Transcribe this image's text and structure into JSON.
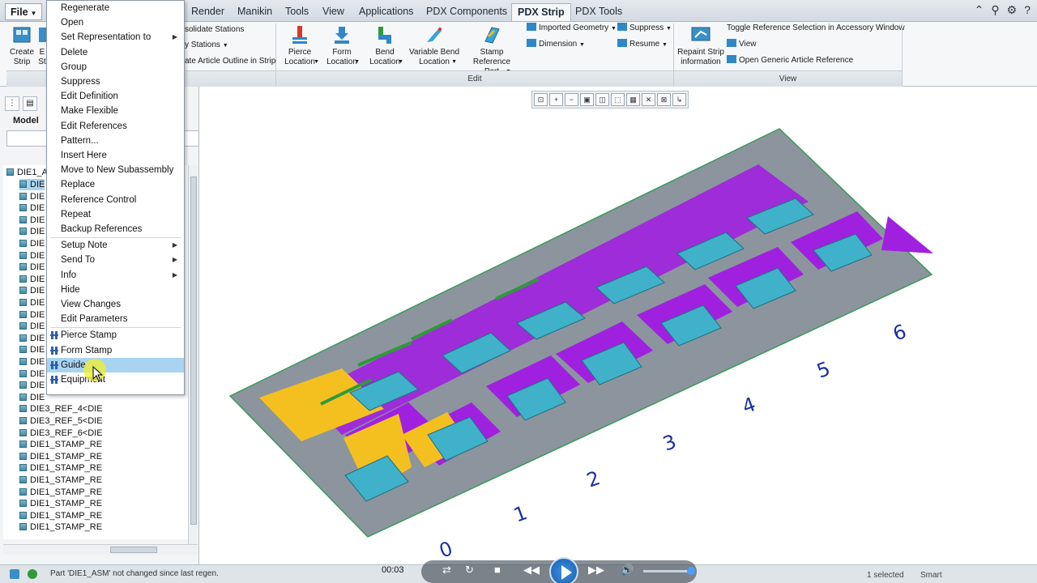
{
  "tabs": {
    "file": "File",
    "items": [
      "Render",
      "Manikin",
      "Tools",
      "View",
      "Applications",
      "PDX Components",
      "PDX Strip",
      "PDX Tools"
    ],
    "active": "PDX Strip"
  },
  "ribbon": {
    "strip_group": {
      "create_strip": "Create\nStrip",
      "create_strip_2": "E\nSt",
      "consolidate_stations": "solidate Stations",
      "copy_stations": "y Stations",
      "article_outline": "ate Article Outline in Strip"
    },
    "edit_group": {
      "label": "Edit",
      "pierce_location": "Pierce\nLocation",
      "form_location": "Form\nLocation",
      "bend_location": "Bend\nLocation",
      "variable_bend_location": "Variable Bend\nLocation",
      "stamp_reference_part": "Stamp Reference\nPart",
      "imported_geometry": "Imported Geometry",
      "dimension": "Dimension",
      "suppress": "Suppress",
      "resume": "Resume"
    },
    "view_group": {
      "label": "View",
      "repaint_strip": "Repaint Strip\ninformation",
      "toggle_reference": "Toggle Reference Selection in Accessory Window",
      "view": "View",
      "open_generic": "Open Generic Article Reference"
    }
  },
  "left_panel": {
    "model_tab": "Model",
    "tree": {
      "root": "DIE1_A",
      "items": [
        "DIE",
        "DIE",
        "DIE",
        "DIE",
        "DIE",
        "DIE",
        "DIE",
        "DIE",
        "DIE",
        "DIE",
        "DIE",
        "DIE",
        "DIE",
        "DIE",
        "DIE",
        "DIE",
        "DIE",
        "DIE",
        "DIE",
        "DIE3_REF_4<DIE",
        "DIE3_REF_5<DIE",
        "DIE3_REF_6<DIE",
        "DIE1_STAMP_RE",
        "DIE1_STAMP_RE",
        "DIE1_STAMP_RE",
        "DIE1_STAMP_RE",
        "DIE1_STAMP_RE",
        "DIE1_STAMP_RE",
        "DIE1_STAMP_RE",
        "DIE1_STAMP_RE"
      ]
    }
  },
  "context_menu": {
    "items": [
      {
        "label": "Regenerate"
      },
      {
        "label": "Open"
      },
      {
        "label": "Set Representation to",
        "submenu": true
      },
      {
        "label": "Delete"
      },
      {
        "label": "Group"
      },
      {
        "label": "Suppress"
      },
      {
        "label": "Edit Definition"
      },
      {
        "label": "Make Flexible"
      },
      {
        "label": "Edit References"
      },
      {
        "label": "Pattern..."
      },
      {
        "label": "Insert Here"
      },
      {
        "label": "Move to New Subassembly"
      },
      {
        "label": "Replace"
      },
      {
        "label": "Reference Control"
      },
      {
        "label": "Repeat"
      },
      {
        "label": "Backup References"
      },
      {
        "label": "Setup Note",
        "submenu": true
      },
      {
        "label": "Send To",
        "submenu": true
      },
      {
        "label": "Info",
        "submenu": true
      },
      {
        "label": "Hide"
      },
      {
        "label": "View Changes"
      },
      {
        "label": "Edit Parameters"
      },
      {
        "label": "Pierce Stamp",
        "icon": "pierce-stamp-icon"
      },
      {
        "label": "Form Stamp",
        "icon": "form-stamp-icon"
      },
      {
        "label": "Guide",
        "icon": "guide-icon",
        "highlighted": true
      },
      {
        "label": "Equipment",
        "icon": "equipment-icon"
      }
    ]
  },
  "graphics": {
    "station_numbers": [
      "0",
      "1",
      "2",
      "3",
      "4",
      "5",
      "6"
    ],
    "colors": {
      "plate": "#8c959d",
      "purple": "#a020e0",
      "teal": "#3fb1c8",
      "yellow": "#f4c020",
      "green": "#2e9a3a",
      "numbers": "#1a2fa8"
    }
  },
  "status": {
    "message": "Part 'DIE1_ASM' not changed since last regen.",
    "selected": "1 selected",
    "filter": "Smart"
  },
  "player": {
    "time": "00:03"
  }
}
